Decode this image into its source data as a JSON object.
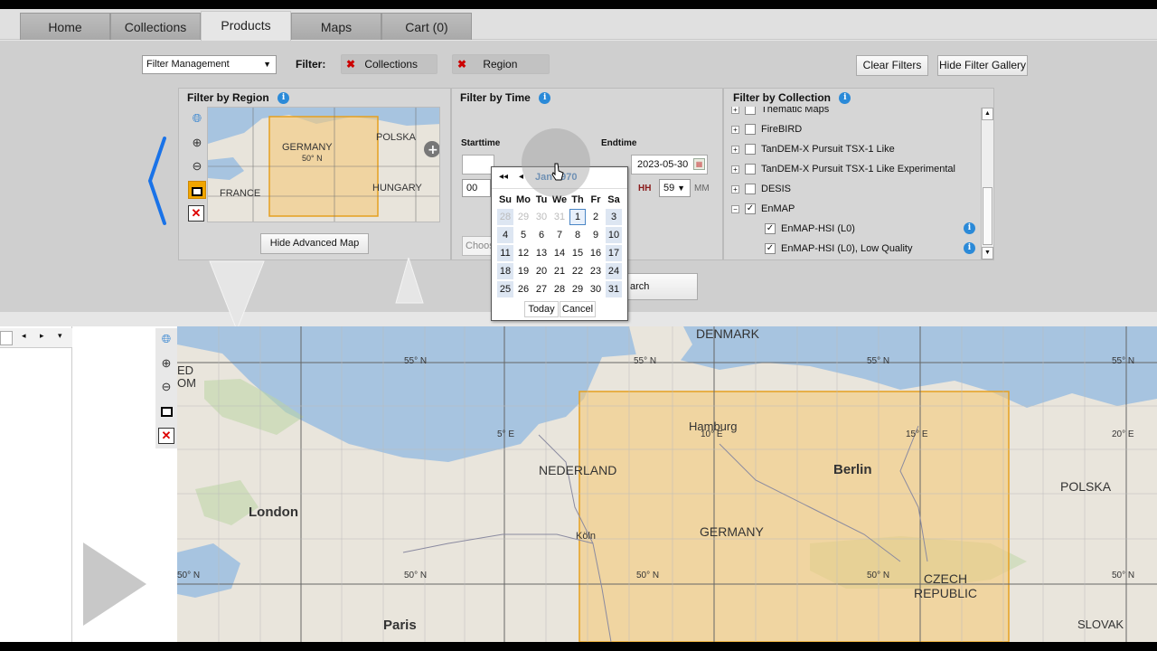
{
  "nav": {
    "tabs": [
      {
        "label": "Home"
      },
      {
        "label": "Collections"
      },
      {
        "label": "Products"
      },
      {
        "label": "Maps"
      },
      {
        "label": "Cart (0)"
      }
    ],
    "active_tab": "Products"
  },
  "filterbar": {
    "filter_management": "Filter Management",
    "filter_label": "Filter:",
    "chips": [
      {
        "label": "Collections"
      },
      {
        "label": "Region"
      }
    ],
    "clear_filters": "Clear Filters",
    "hide_gallery": "Hide Filter Gallery"
  },
  "region_panel": {
    "title": "Filter by Region",
    "minimap_labels": [
      "GERMANY",
      "50° N",
      "POLSKA",
      "FRANCE",
      "HUNGARY"
    ],
    "hide_map_button": "Hide Advanced Map"
  },
  "time_panel": {
    "title": "Filter by Time",
    "start_label": "Starttime",
    "end_label": "Endtime",
    "end_date": "2023-05-30",
    "start_hour": "00",
    "end_hour": "59",
    "hh": "HH",
    "mm": "MM",
    "choose_placeholder": "Choos",
    "search_button": "arch"
  },
  "calendar": {
    "month": "Jan 1970",
    "prev_year": "◂◂",
    "prev_month": "◂",
    "weekdays": [
      "Su",
      "Mo",
      "Tu",
      "We",
      "Th",
      "Fr",
      "Sa"
    ],
    "weeks": [
      [
        "28",
        "29",
        "30",
        "31",
        "1",
        "2",
        "3"
      ],
      [
        "4",
        "5",
        "6",
        "7",
        "8",
        "9",
        "10"
      ],
      [
        "11",
        "12",
        "13",
        "14",
        "15",
        "16",
        "17"
      ],
      [
        "18",
        "19",
        "20",
        "21",
        "22",
        "23",
        "24"
      ],
      [
        "25",
        "26",
        "27",
        "28",
        "29",
        "30",
        "31"
      ]
    ],
    "today": "Today",
    "cancel": "Cancel"
  },
  "collection_panel": {
    "title": "Filter by Collection",
    "items": [
      {
        "label": "Thematic Maps",
        "checked": false,
        "indent": 0
      },
      {
        "label": "FireBIRD",
        "checked": false,
        "indent": 0
      },
      {
        "label": "TanDEM-X Pursuit TSX-1 Like",
        "checked": false,
        "indent": 0
      },
      {
        "label": "TanDEM-X Pursuit TSX-1 Like Experimental",
        "checked": false,
        "indent": 0
      },
      {
        "label": "DESIS",
        "checked": false,
        "indent": 0
      },
      {
        "label": "EnMAP",
        "checked": true,
        "indent": 0
      },
      {
        "label": "EnMAP-HSI (L0)",
        "checked": true,
        "indent": 1
      },
      {
        "label": "EnMAP-HSI (L0), Low Quality",
        "checked": true,
        "indent": 1
      }
    ]
  },
  "map": {
    "labels": {
      "denmark": "DENMARK",
      "hamburg": "Hamburg",
      "berlin": "Berlin",
      "nederland": "NEDERLAND",
      "germany": "GERMANY",
      "london": "London",
      "paris": "Paris",
      "polska": "POLSKA",
      "czech": "CZECH REPUBLIC",
      "slovak": "SLOVAK",
      "koln": "Köln",
      "ed": "ED",
      "om": "OM"
    },
    "grid_labels": {
      "lat55a": "55° N",
      "lat55b": "55° N",
      "lat55c": "55° N",
      "lat55d": "55° N",
      "lon5": "5° E",
      "lon10": "10° E",
      "lon15": "15° E",
      "lon20": "20° E",
      "lat50a": "50° N",
      "lat50b": "50° N",
      "lat50c": "50° N",
      "lat50d": "50° N",
      "lat50e": "50° N"
    }
  },
  "colors": {
    "ocean": "#a7c4e0",
    "land": "#e9e5dc",
    "selection": "#f5c97a",
    "selection_border": "#e6a020",
    "info_blue": "#2b8ad8"
  }
}
